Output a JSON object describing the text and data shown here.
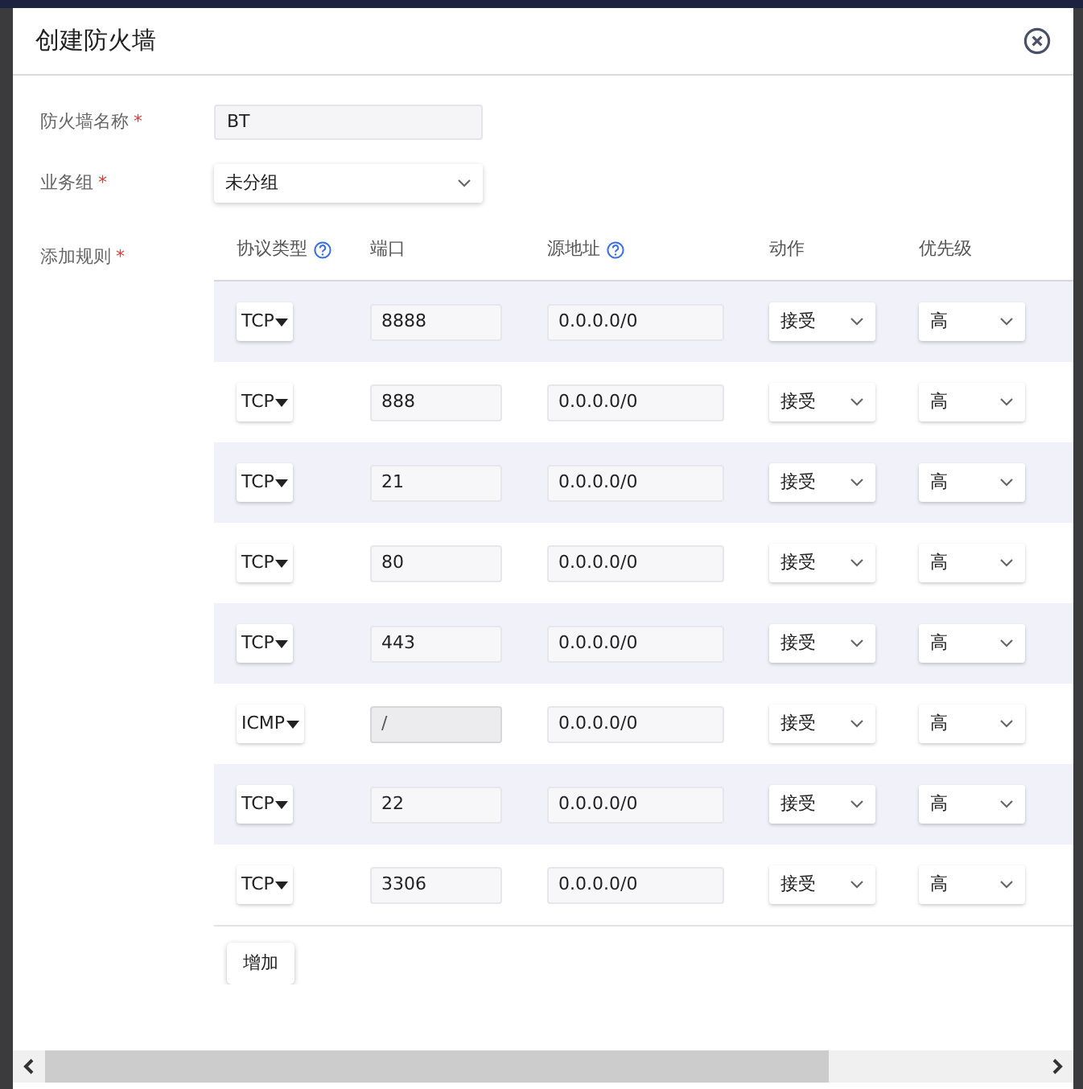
{
  "dialog": {
    "title": "创建防火墙"
  },
  "fields": [
    {
      "kind": "input",
      "label": "防火墙名称",
      "required": "*",
      "value": "BT"
    },
    {
      "kind": "select",
      "label": "业务组",
      "required": "*",
      "value": "未分组"
    }
  ],
  "rules": {
    "label": "添加规则",
    "required": "*",
    "columns": [
      {
        "label": "协议类型",
        "help": true
      },
      {
        "label": "端口",
        "help": false
      },
      {
        "label": "源地址",
        "help": true
      },
      {
        "label": "动作",
        "help": false
      },
      {
        "label": "优先级",
        "help": false
      }
    ],
    "rows": [
      {
        "protocol": "TCP",
        "port": "8888",
        "port_disabled": false,
        "source": "0.0.0.0/0",
        "action": "接受",
        "priority": "高"
      },
      {
        "protocol": "TCP",
        "port": "888",
        "port_disabled": false,
        "source": "0.0.0.0/0",
        "action": "接受",
        "priority": "高"
      },
      {
        "protocol": "TCP",
        "port": "21",
        "port_disabled": false,
        "source": "0.0.0.0/0",
        "action": "接受",
        "priority": "高"
      },
      {
        "protocol": "TCP",
        "port": "80",
        "port_disabled": false,
        "source": "0.0.0.0/0",
        "action": "接受",
        "priority": "高"
      },
      {
        "protocol": "TCP",
        "port": "443",
        "port_disabled": false,
        "source": "0.0.0.0/0",
        "action": "接受",
        "priority": "高"
      },
      {
        "protocol": "ICMP",
        "port": "/",
        "port_disabled": true,
        "source": "0.0.0.0/0",
        "action": "接受",
        "priority": "高"
      },
      {
        "protocol": "TCP",
        "port": "22",
        "port_disabled": false,
        "source": "0.0.0.0/0",
        "action": "接受",
        "priority": "高"
      },
      {
        "protocol": "TCP",
        "port": "3306",
        "port_disabled": false,
        "source": "0.0.0.0/0",
        "action": "接受",
        "priority": "高"
      }
    ],
    "add_button": "增加"
  }
}
